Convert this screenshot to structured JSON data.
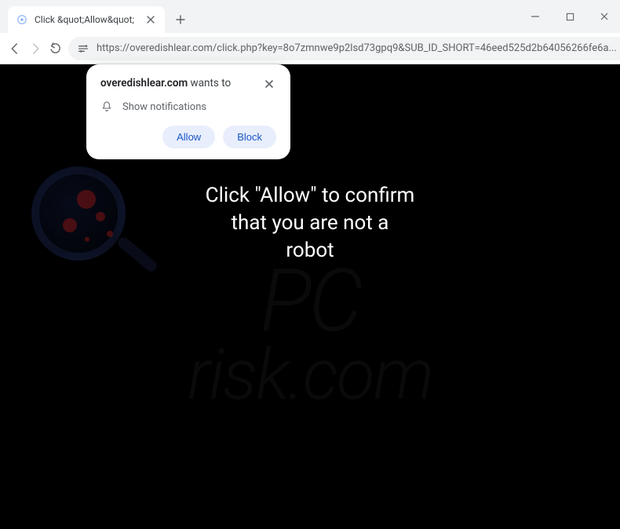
{
  "window": {
    "tab_title": "Click &quot;Allow&quot;"
  },
  "toolbar": {
    "url_display": "https://overedishlear.com/click.php?key=8o7zmnwe9p2lsd73gpq9&SUB_ID_SHORT=46eed525d2b64056266fe6a..."
  },
  "notification": {
    "site": "overedishlear.com",
    "wants_to": " wants to",
    "permission_label": "Show notifications",
    "allow_label": "Allow",
    "block_label": "Block"
  },
  "page": {
    "main_text_line1": "Click \"Allow\" to confirm",
    "main_text_line2": "that you are not a",
    "main_text_line3": "robot",
    "watermark_pc": "PC",
    "watermark_risk": "risk.com"
  }
}
